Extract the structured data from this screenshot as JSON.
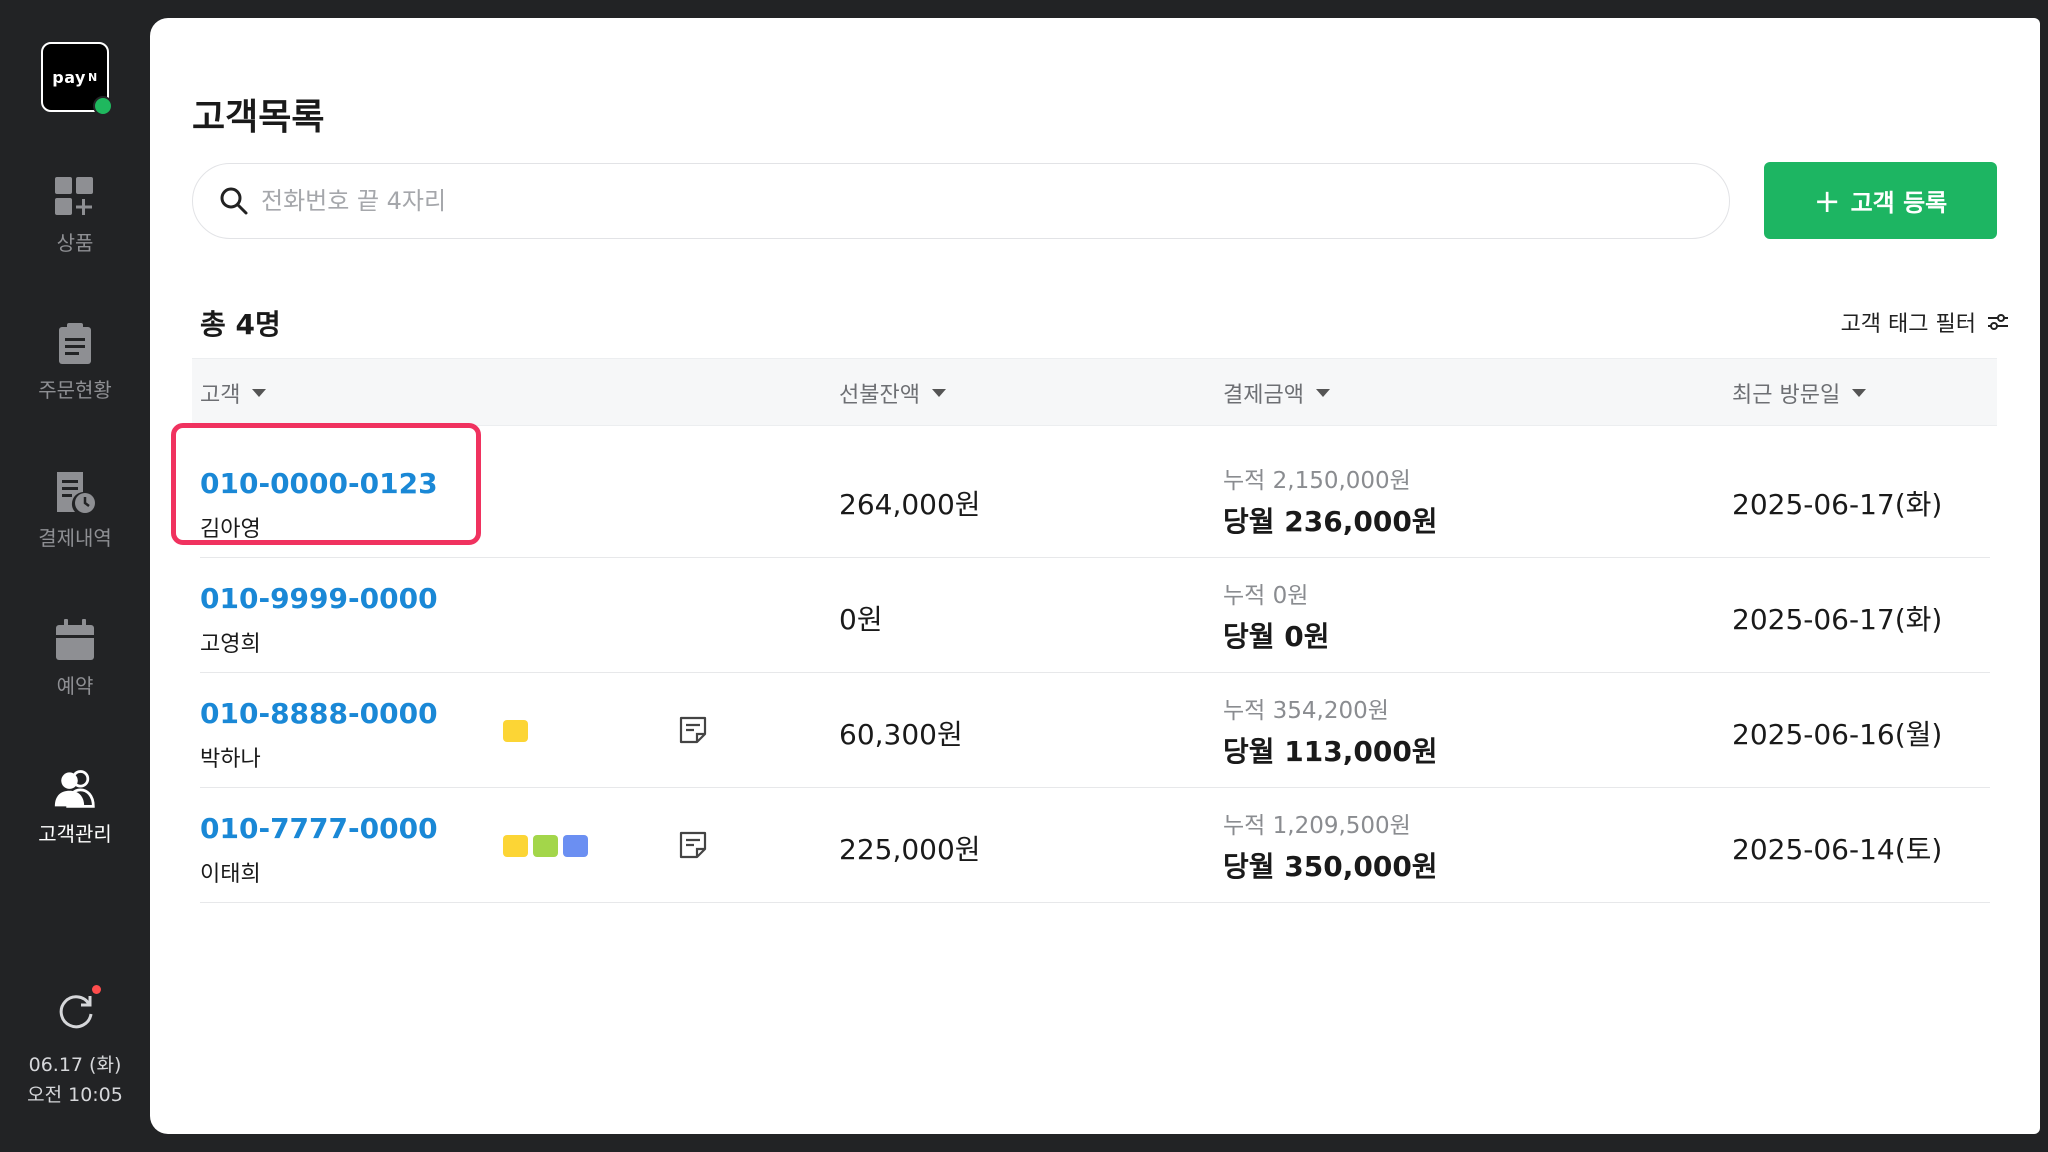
{
  "app": {
    "logo_text": "pay",
    "logo_suffix": "N"
  },
  "sidebar": {
    "items": [
      {
        "label": "상품",
        "icon": "grid-plus-icon",
        "active": false
      },
      {
        "label": "주문현황",
        "icon": "clipboard-icon",
        "active": false
      },
      {
        "label": "결제내역",
        "icon": "receipt-clock-icon",
        "active": false
      },
      {
        "label": "예약",
        "icon": "calendar-icon",
        "active": false
      },
      {
        "label": "고객관리",
        "icon": "users-icon",
        "active": true
      }
    ],
    "date": "06.17 (화)",
    "time": "오전 10:05"
  },
  "main": {
    "title": "고객목록",
    "search_placeholder": "전화번호 끝 4자리",
    "add_button": "고객 등록",
    "total": "총 4명",
    "tag_filter": "고객 태그 필터",
    "columns": [
      "고객",
      "선불잔액",
      "결제금액",
      "최근 방문일"
    ],
    "rows": [
      {
        "phone": "010-0000-0123",
        "name": "김아영",
        "tags": [],
        "memo": false,
        "prepaid": "264,000원",
        "cumulative": "누적 2,150,000원",
        "monthly": "당월 236,000원",
        "last_visit": "2025-06-17(화)"
      },
      {
        "phone": "010-9999-0000",
        "name": "고영희",
        "tags": [],
        "memo": false,
        "prepaid": "0원",
        "cumulative": "누적 0원",
        "monthly": "당월 0원",
        "last_visit": "2025-06-17(화)"
      },
      {
        "phone": "010-8888-0000",
        "name": "박하나",
        "tags": [
          "#fcd535"
        ],
        "memo": true,
        "prepaid": "60,300원",
        "cumulative": "누적 354,200원",
        "monthly": "당월 113,000원",
        "last_visit": "2025-06-16(월)"
      },
      {
        "phone": "010-7777-0000",
        "name": "이태희",
        "tags": [
          "#fcd535",
          "#a3d64a",
          "#6b8ff2"
        ],
        "memo": true,
        "prepaid": "225,000원",
        "cumulative": "누적 1,209,500원",
        "monthly": "당월 350,000원",
        "last_visit": "2025-06-14(토)"
      }
    ]
  },
  "colors": {
    "accent": "#1db562",
    "link": "#1a88d6",
    "highlight": "#f0325f"
  }
}
